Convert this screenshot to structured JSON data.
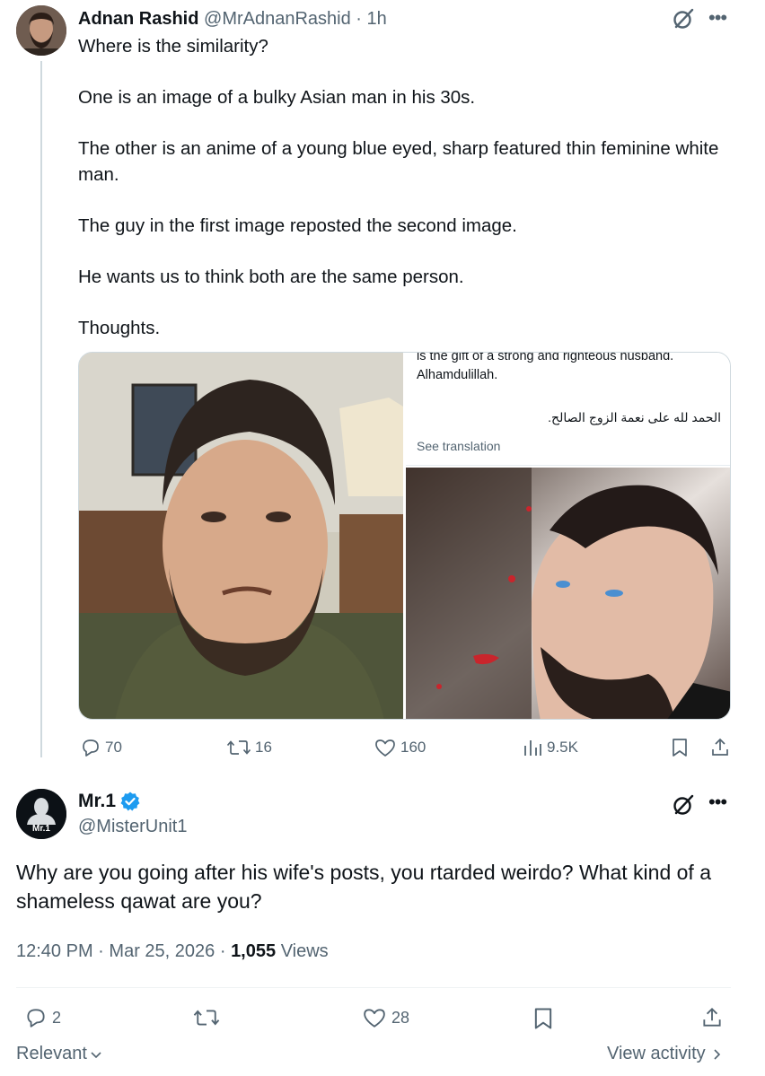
{
  "tweet1": {
    "author_name": "Adnan Rashid",
    "handle": "@MrAdnanRashid",
    "separator": "·",
    "time": "1h",
    "paragraphs": [
      "Where is the similarity?",
      "One is an image of a bulky Asian man in his 30s.",
      "The other is an anime of a young blue eyed, sharp featured thin feminine white man.",
      "The guy in the first image reposted the second image.",
      "He wants us to think both are the same person.",
      "Thoughts."
    ],
    "media": {
      "right_top_text_line1": "is the gift of a strong and righteous husband.",
      "right_top_text_line2": "Alhamdulillah.",
      "right_top_arabic": "الحمد لله على نعمة الزوج الصالح.",
      "right_top_translate": "See translation"
    },
    "actions": {
      "replies": "70",
      "reposts": "16",
      "likes": "160",
      "views": "9.5K"
    }
  },
  "tweet2": {
    "author_name": "Mr.1",
    "avatar_text": "Mr.1",
    "handle": "@MisterUnit1",
    "verified_color": "#1d9bf0",
    "body": "Why are you going after his wife's posts, you rtarded weirdo? What kind of a shameless qawat are you?",
    "time": "12:40 PM",
    "date": "Mar 25, 2026",
    "separator": "·",
    "views_count": "1,055",
    "views_label": "Views",
    "actions": {
      "replies": "2",
      "likes": "28"
    }
  },
  "footer": {
    "relevant_label": "Relevant",
    "view_activity_label": "View activity"
  },
  "icons": [
    "grok-icon",
    "more-icon",
    "reply-icon",
    "repost-icon",
    "like-icon",
    "views-icon",
    "bookmark-icon",
    "share-icon",
    "verified-badge-icon",
    "chevron-down-icon",
    "chevron-right-icon"
  ]
}
